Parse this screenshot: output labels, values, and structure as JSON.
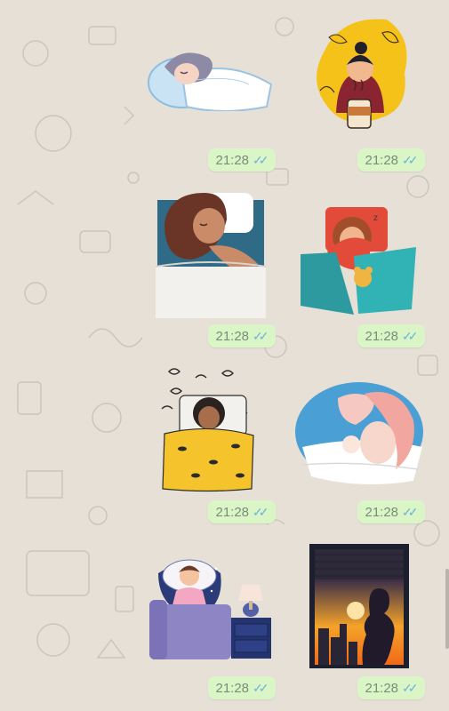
{
  "messages": [
    {
      "sticker": "sleeping-woman-pillow",
      "time": "21:28",
      "status": "read"
    },
    {
      "sticker": "woman-coffee-cup",
      "time": "21:28",
      "status": "read"
    },
    {
      "sticker": "woman-sleeping-bed",
      "time": "21:28",
      "status": "read"
    },
    {
      "sticker": "woman-teddy-bear-teal-blanket",
      "time": "21:28",
      "status": "read"
    },
    {
      "sticker": "woman-awake-yellow-blanket",
      "time": "21:28",
      "status": "read"
    },
    {
      "sticker": "mother-baby-bed",
      "time": "21:28",
      "status": "read"
    },
    {
      "sticker": "woman-sitting-bed-lamp",
      "time": "21:28",
      "status": "read"
    },
    {
      "sticker": "pregnant-woman-window-sunset",
      "time": "21:28",
      "status": "read"
    }
  ],
  "ticks_glyph": "✓✓",
  "colors": {
    "bubble": "#dbf6c6",
    "read_ticks": "#6fb3d9",
    "wallpaper": "#e6e0d6"
  }
}
